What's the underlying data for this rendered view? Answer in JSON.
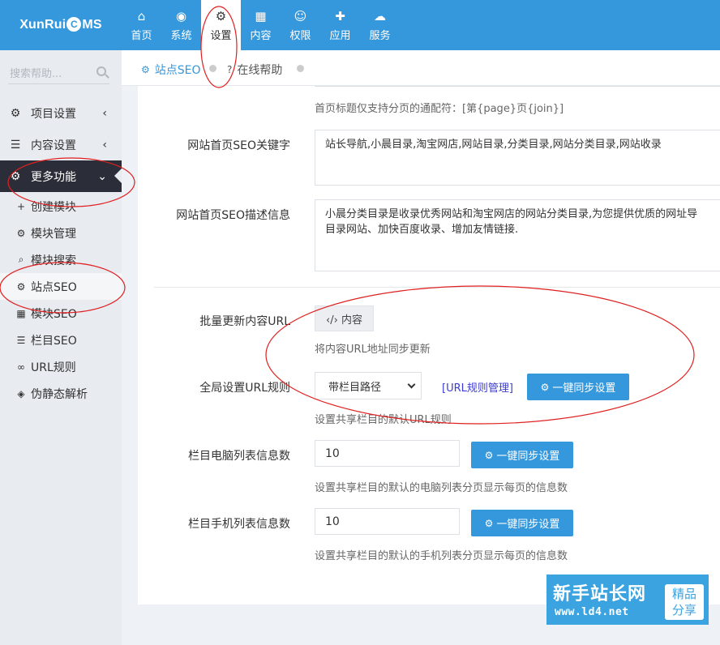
{
  "brand": {
    "prefix": "XunRui",
    "badge": "C",
    "suffix": "MS"
  },
  "nav": [
    {
      "icon": "home-icon",
      "glyph": "⌂",
      "label": "首页"
    },
    {
      "icon": "globe-icon",
      "glyph": "◉",
      "label": "系统"
    },
    {
      "icon": "cogs-icon",
      "glyph": "⚙",
      "label": "设置"
    },
    {
      "icon": "grid-icon",
      "glyph": "▦",
      "label": "内容"
    },
    {
      "icon": "user-icon",
      "glyph": "☺",
      "label": "权限"
    },
    {
      "icon": "puzzle-icon",
      "glyph": "✚",
      "label": "应用"
    },
    {
      "icon": "cloud-icon",
      "glyph": "☁",
      "label": "服务"
    }
  ],
  "sidebar": {
    "search_placeholder": "搜索帮助...",
    "sections": [
      {
        "label": "项目设置",
        "glyph": "⚙",
        "chevron": "‹"
      },
      {
        "label": "内容设置",
        "glyph": "☰",
        "chevron": "‹"
      },
      {
        "label": "更多功能",
        "glyph": "⚙",
        "chevron": "⌄"
      }
    ],
    "items": [
      {
        "label": "创建模块",
        "glyph": "+"
      },
      {
        "label": "模块管理",
        "glyph": "⚙"
      },
      {
        "label": "模块搜索",
        "glyph": "⌕"
      },
      {
        "label": "站点SEO",
        "glyph": "⚙"
      },
      {
        "label": "模块SEO",
        "glyph": "▦"
      },
      {
        "label": "栏目SEO",
        "glyph": "☰"
      },
      {
        "label": "URL规则",
        "glyph": "∞"
      },
      {
        "label": "伪静态解析",
        "glyph": "◈"
      }
    ]
  },
  "tabs": [
    {
      "label": "站点SEO",
      "glyph": "⚙"
    },
    {
      "label": "在线帮助",
      "glyph": "?"
    }
  ],
  "form": {
    "title_help": "首页标题仅支持分页的通配符：[第{page}页{join}]",
    "keywords_label": "网站首页SEO关键字",
    "keywords_value": "站长导航,小晨目录,淘宝网店,网站目录,分类目录,网站分类目录,网站收录",
    "desc_label": "网站首页SEO描述信息",
    "desc_line1": "小晨分类目录是收录优秀网站和淘宝网店的网站分类目录,为您提供优质的网址导",
    "desc_line2": "目录网站、加快百度收录、增加友情链接.",
    "batch_label": "批量更新内容URL",
    "batch_button": "‹/› 内容",
    "batch_help": "将内容URL地址同步更新",
    "url_label": "全局设置URL规则",
    "url_select": "带栏目路径",
    "url_link": "[URL规则管理]",
    "sync_button": "一键同步设置",
    "url_help": "设置共享栏目的默认URL规则",
    "pc_label": "栏目电脑列表信息数",
    "pc_value": "10",
    "pc_help": "设置共享栏目的默认的电脑列表分页显示每页的信息数",
    "mobile_label": "栏目手机列表信息数",
    "mobile_value": "10",
    "mobile_help": "设置共享栏目的默认的手机列表分页显示每页的信息数"
  },
  "watermark": {
    "title": "新手站长网",
    "url": "www.ld4.net",
    "badge_line1": "精品",
    "badge_line2": "分享"
  },
  "colors": {
    "accent": "#3598dc",
    "sidebar_active": "#2b2e38",
    "annotation": "#e02020"
  }
}
